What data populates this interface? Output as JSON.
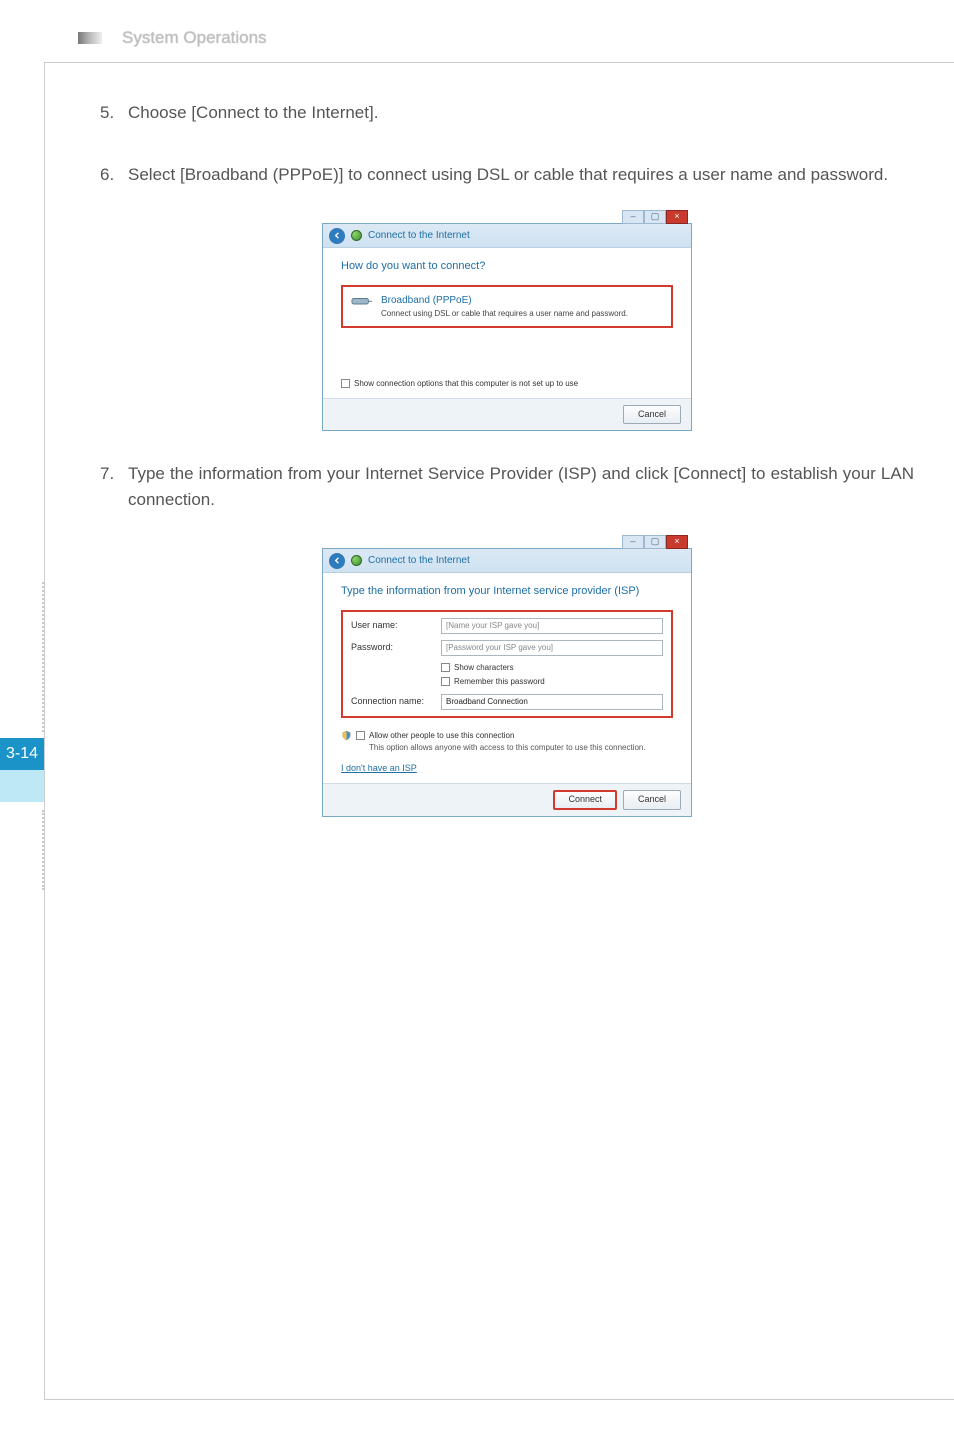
{
  "header": {
    "title": "System Operations"
  },
  "page_number": "3-14",
  "steps": {
    "s5": {
      "num": "5.",
      "text": "Choose [Connect to the Internet]."
    },
    "s6": {
      "num": "6.",
      "text": "Select [Broadband (PPPoE)] to connect using DSL or cable that requires a user name and password."
    },
    "s7": {
      "num": "7.",
      "text": "Type the information from your Internet Service Provider (ISP) and click [Connect] to establish your LAN connection."
    }
  },
  "dialog1": {
    "title": "Connect to the Internet",
    "heading": "How do you want to connect?",
    "option_title": "Broadband (PPPoE)",
    "option_sub": "Connect using DSL or cable that requires a user name and password.",
    "checkbox": "Show connection options that this computer is not set up to use",
    "cancel": "Cancel"
  },
  "dialog2": {
    "title": "Connect to the Internet",
    "heading": "Type the information from your Internet service provider (ISP)",
    "user_label": "User name:",
    "user_placeholder": "[Name your ISP gave you]",
    "pass_label": "Password:",
    "pass_placeholder": "[Password your ISP gave you]",
    "show_chars": "Show characters",
    "remember": "Remember this password",
    "conn_label": "Connection name:",
    "conn_value": "Broadband Connection",
    "allow_others": "Allow other people to use this connection",
    "allow_desc": "This option allows anyone with access to this computer to use this connection.",
    "no_isp": "I don't have an ISP",
    "connect": "Connect",
    "cancel": "Cancel"
  }
}
